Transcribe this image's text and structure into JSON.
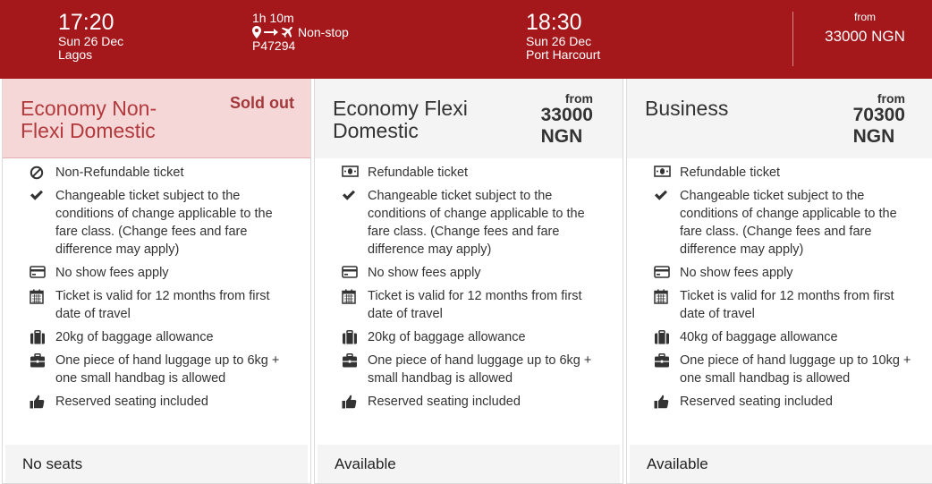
{
  "flight": {
    "departure": {
      "time": "17:20",
      "date": "Sun 26 Dec",
      "city": "Lagos"
    },
    "duration": "1h 10m",
    "stops": "Non-stop",
    "flight_number": "P47294",
    "arrival": {
      "time": "18:30",
      "date": "Sun 26 Dec",
      "city": "Port Harcourt"
    },
    "from_label": "from",
    "from_price": "33000 NGN"
  },
  "fares": [
    {
      "name": "Economy Non-Flexi Domestic",
      "status_badge": "Sold out",
      "features": [
        {
          "icon": "ban-icon",
          "text": "Non-Refundable ticket"
        },
        {
          "icon": "check-icon",
          "text": "Changeable ticket subject to the conditions of change applicable to the fare class. (Change fees and fare difference may apply)"
        },
        {
          "icon": "credit-card-icon",
          "text": "No show fees apply"
        },
        {
          "icon": "calendar-icon",
          "text": "Ticket is valid for 12 months from first date of travel"
        },
        {
          "icon": "suitcase-icon",
          "text": "20kg of baggage allowance"
        },
        {
          "icon": "briefcase-icon",
          "text": "One piece of hand luggage up to 6kg + one small handbag is allowed"
        },
        {
          "icon": "thumbs-up-icon",
          "text": "Reserved seating included"
        }
      ],
      "availability": "No seats"
    },
    {
      "name": "Economy Flexi Domestic",
      "price_from_label": "from",
      "price_amount": "33000",
      "price_currency": "NGN",
      "features": [
        {
          "icon": "money-icon",
          "text": "Refundable ticket"
        },
        {
          "icon": "check-icon",
          "text": "Changeable ticket subject to the conditions of change applicable to the fare class. (Change fees and fare difference may apply)"
        },
        {
          "icon": "credit-card-icon",
          "text": "No show fees apply"
        },
        {
          "icon": "calendar-icon",
          "text": "Ticket is valid for 12 months from first date of travel"
        },
        {
          "icon": "suitcase-icon",
          "text": "20kg of baggage allowance"
        },
        {
          "icon": "briefcase-icon",
          "text": "One piece of hand luggage up to 6kg + small handbag is allowed"
        },
        {
          "icon": "thumbs-up-icon",
          "text": "Reserved seating included"
        }
      ],
      "availability": "Available"
    },
    {
      "name": "Business",
      "price_from_label": "from",
      "price_amount": "70300",
      "price_currency": "NGN",
      "features": [
        {
          "icon": "money-icon",
          "text": "Refundable ticket"
        },
        {
          "icon": "check-icon",
          "text": "Changeable ticket subject to the conditions of change applicable to the fare class. (Change fees and fare difference may apply)"
        },
        {
          "icon": "credit-card-icon",
          "text": "No show fees apply"
        },
        {
          "icon": "calendar-icon",
          "text": "Ticket is valid for 12 months from first date of travel"
        },
        {
          "icon": "suitcase-icon",
          "text": "40kg of baggage allowance"
        },
        {
          "icon": "briefcase-icon",
          "text": "One piece of hand luggage up to 10kg + one small handbag is allowed"
        },
        {
          "icon": "thumbs-up-icon",
          "text": "Reserved seating included"
        }
      ],
      "availability": "Available"
    }
  ],
  "colors": {
    "header_bg": "#a4181c",
    "sold_out_bg": "#f6d7d8",
    "sold_out_text": "#b2393c",
    "panel_bg": "#f4f4f4"
  }
}
